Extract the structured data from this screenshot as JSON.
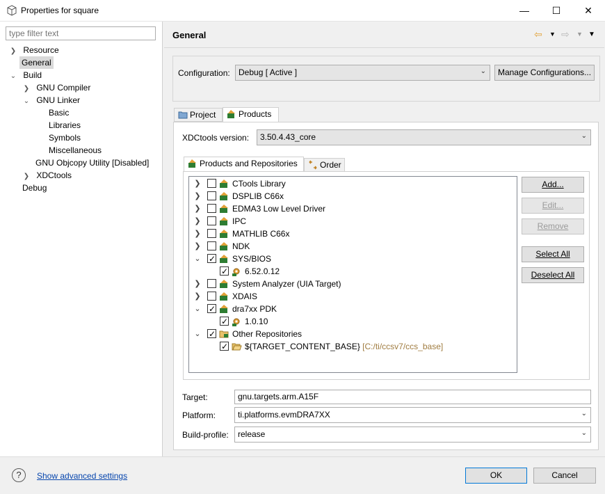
{
  "window": {
    "title": "Properties for square",
    "minimize": "—",
    "maximize": "☐",
    "close": "✕"
  },
  "left": {
    "filter_placeholder": "type filter text",
    "tree": {
      "resource": "Resource",
      "general": "General",
      "build": "Build",
      "gnu_compiler": "GNU Compiler",
      "gnu_linker": "GNU Linker",
      "basic": "Basic",
      "libraries": "Libraries",
      "symbols": "Symbols",
      "miscellaneous": "Miscellaneous",
      "gnu_objcopy": "GNU Objcopy Utility  [Disabled]",
      "xdctools": "XDCtools",
      "debug": "Debug"
    }
  },
  "header": {
    "title": "General"
  },
  "configuration": {
    "label": "Configuration:",
    "value": "Debug  [ Active ]",
    "manage_button": "Manage Configurations..."
  },
  "tabs": {
    "project": "Project",
    "products": "Products"
  },
  "xdc": {
    "label": "XDCtools version:",
    "value": "3.50.4.43_core"
  },
  "inner_tabs": {
    "products_repos": "Products and Repositories",
    "order": "Order"
  },
  "repos": [
    {
      "label": "CTools Library",
      "checked": false,
      "expander": "collapsed"
    },
    {
      "label": "DSPLIB C66x",
      "checked": false,
      "expander": "collapsed"
    },
    {
      "label": "EDMA3 Low Level Driver",
      "checked": false,
      "expander": "collapsed"
    },
    {
      "label": "IPC",
      "checked": false,
      "expander": "collapsed"
    },
    {
      "label": "MATHLIB C66x",
      "checked": false,
      "expander": "collapsed"
    },
    {
      "label": "NDK",
      "checked": false,
      "expander": "collapsed"
    },
    {
      "label": "SYS/BIOS",
      "checked": true,
      "expander": "expanded"
    },
    {
      "label": "6.52.0.12",
      "checked": true,
      "child": true
    },
    {
      "label": "System Analyzer (UIA Target)",
      "checked": false,
      "expander": "collapsed"
    },
    {
      "label": "XDAIS",
      "checked": false,
      "expander": "collapsed"
    },
    {
      "label": "dra7xx PDK",
      "checked": true,
      "expander": "expanded"
    },
    {
      "label": "1.0.10",
      "checked": true,
      "child": true
    },
    {
      "label": "Other Repositories",
      "checked": true,
      "expander": "expanded"
    },
    {
      "label": "${TARGET_CONTENT_BASE}",
      "path": "[C:/ti/ccsv7/ccs_base]",
      "checked": true,
      "child": true
    }
  ],
  "side_buttons": {
    "add": "Add...",
    "edit": "Edit...",
    "remove": "Remove",
    "select_all": "Select All",
    "deselect_all": "Deselect All"
  },
  "target": {
    "label": "Target:",
    "value": "gnu.targets.arm.A15F"
  },
  "platform": {
    "label": "Platform:",
    "value": "ti.platforms.evmDRA7XX"
  },
  "build_profile": {
    "label": "Build-profile:",
    "value": "release"
  },
  "footer": {
    "help": "?",
    "advanced_link": "Show advanced settings",
    "ok": "OK",
    "cancel": "Cancel"
  }
}
